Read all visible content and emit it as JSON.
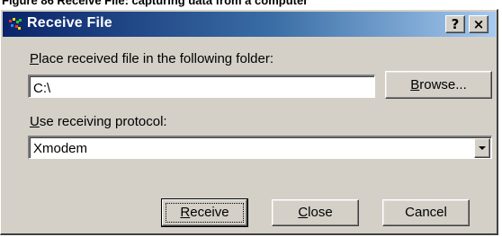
{
  "caption_text": "Figure 86 Receive File: capturing data from a computer",
  "window": {
    "title": "Receive File",
    "help_label": "?",
    "close_label": "×"
  },
  "folder": {
    "label_accel": "P",
    "label_rest": "lace received file in the following folder:",
    "value": "C:\\",
    "browse_accel": "B",
    "browse_rest": "rowse..."
  },
  "protocol": {
    "label_accel": "U",
    "label_rest": "se receiving protocol:",
    "selected": "Xmodem"
  },
  "buttons": {
    "receive_accel": "R",
    "receive_rest": "eceive",
    "close_accel": "C",
    "close_rest": "lose",
    "cancel_label": "Cancel"
  },
  "icons": {
    "title_icon": "receive-file-app-icon",
    "dropdown": "chevron-down-icon"
  }
}
